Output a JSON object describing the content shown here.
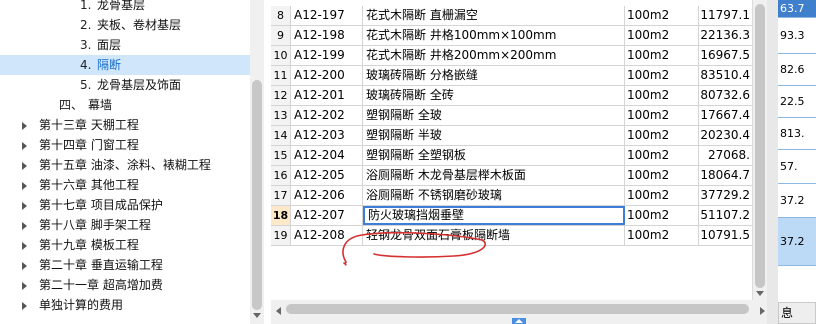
{
  "tree": {
    "items": [
      {
        "num": "1.",
        "label": "龙骨基层",
        "arrow": false,
        "indent": 2,
        "selected": false
      },
      {
        "num": "2.",
        "label": "夹板、卷材基层",
        "arrow": false,
        "indent": 2,
        "selected": false
      },
      {
        "num": "3.",
        "label": "面层",
        "arrow": false,
        "indent": 2,
        "selected": false
      },
      {
        "num": "4.",
        "label": "隔断",
        "arrow": false,
        "indent": 2,
        "selected": true
      },
      {
        "num": "5.",
        "label": "龙骨基层及饰面",
        "arrow": false,
        "indent": 2,
        "selected": false
      },
      {
        "num": "四、",
        "label": "幕墙",
        "arrow": false,
        "indent": 1,
        "selected": false
      },
      {
        "num": "",
        "label": "第十三章 天棚工程",
        "arrow": true,
        "indent": 0,
        "selected": false
      },
      {
        "num": "",
        "label": "第十四章 门窗工程",
        "arrow": true,
        "indent": 0,
        "selected": false
      },
      {
        "num": "",
        "label": "第十五章 油漆、涂料、裱糊工程",
        "arrow": true,
        "indent": 0,
        "selected": false
      },
      {
        "num": "",
        "label": "第十六章 其他工程",
        "arrow": true,
        "indent": 0,
        "selected": false
      },
      {
        "num": "",
        "label": "第十七章 项目成品保护",
        "arrow": true,
        "indent": 0,
        "selected": false
      },
      {
        "num": "",
        "label": "第十八章 脚手架工程",
        "arrow": true,
        "indent": 0,
        "selected": false
      },
      {
        "num": "",
        "label": "第十九章 模板工程",
        "arrow": true,
        "indent": 0,
        "selected": false
      },
      {
        "num": "",
        "label": "第二十章 垂直运输工程",
        "arrow": true,
        "indent": 0,
        "selected": false
      },
      {
        "num": "",
        "label": "第二十一章 超高增加费",
        "arrow": true,
        "indent": 0,
        "selected": false
      },
      {
        "num": "",
        "label": "单独计算的费用",
        "arrow": true,
        "indent": 0,
        "selected": false
      }
    ]
  },
  "grid": {
    "rows": [
      {
        "no": "8",
        "code": "A12-197",
        "name": "花式木隔断 直栅漏空",
        "unit": "100m2",
        "price": "11797.1"
      },
      {
        "no": "9",
        "code": "A12-198",
        "name": "花式木隔断 井格100mm×100mm",
        "unit": "100m2",
        "price": "22136.3"
      },
      {
        "no": "10",
        "code": "A12-199",
        "name": "花式木隔断 井格200mm×200mm",
        "unit": "100m2",
        "price": "16967.5"
      },
      {
        "no": "11",
        "code": "A12-200",
        "name": "玻璃砖隔断 分格嵌缝",
        "unit": "100m2",
        "price": "83510.4"
      },
      {
        "no": "12",
        "code": "A12-201",
        "name": "玻璃砖隔断 全砖",
        "unit": "100m2",
        "price": "80732.6"
      },
      {
        "no": "13",
        "code": "A12-202",
        "name": "塑钢隔断 全玻",
        "unit": "100m2",
        "price": "17667.4"
      },
      {
        "no": "14",
        "code": "A12-203",
        "name": "塑钢隔断 半玻",
        "unit": "100m2",
        "price": "20230.4"
      },
      {
        "no": "15",
        "code": "A12-204",
        "name": "塑钢隔断 全塑钢板",
        "unit": "100m2",
        "price": "27068."
      },
      {
        "no": "16",
        "code": "A12-205",
        "name": "浴厕隔断 木龙骨基层榉木板面",
        "unit": "100m2",
        "price": "18064.7"
      },
      {
        "no": "17",
        "code": "A12-206",
        "name": "浴厕隔断 不锈钢磨砂玻璃",
        "unit": "100m2",
        "price": "37729.2"
      },
      {
        "no": "18",
        "code": "A12-207",
        "name": "防火玻璃挡烟垂壁",
        "unit": "100m2",
        "price": "51107.2",
        "current": true
      },
      {
        "no": "19",
        "code": "A12-208",
        "name": "轻钢龙骨双面石膏板隔断墙",
        "unit": "100m2",
        "price": "10791.5"
      }
    ]
  },
  "right_pane": {
    "cells": [
      {
        "text": "63.7",
        "bg": "#3f7fcc",
        "color": "#ffffff"
      },
      {
        "text": "93.3",
        "bg": "#ffffff",
        "color": "#000000"
      },
      {
        "text": "82.6",
        "bg": "#ffffff",
        "color": "#000000"
      },
      {
        "text": "22.5",
        "bg": "#ffffff",
        "color": "#000000"
      },
      {
        "text": "813.",
        "bg": "#ffffff",
        "color": "#000000"
      },
      {
        "text": "57.",
        "bg": "#ffffff",
        "color": "#000000"
      },
      {
        "text": "37.2",
        "bg": "#ffffff",
        "color": "#000000"
      },
      {
        "text": "37.2",
        "bg": "#bcd9f6",
        "color": "#000000"
      }
    ],
    "tab_label": "息"
  },
  "colors": {
    "selection_bg": "#cfe6fb",
    "current_row_border": "#3d7fd8",
    "annotation_red": "#d62f2f",
    "right_pane_accent": "#3f7fcc"
  }
}
